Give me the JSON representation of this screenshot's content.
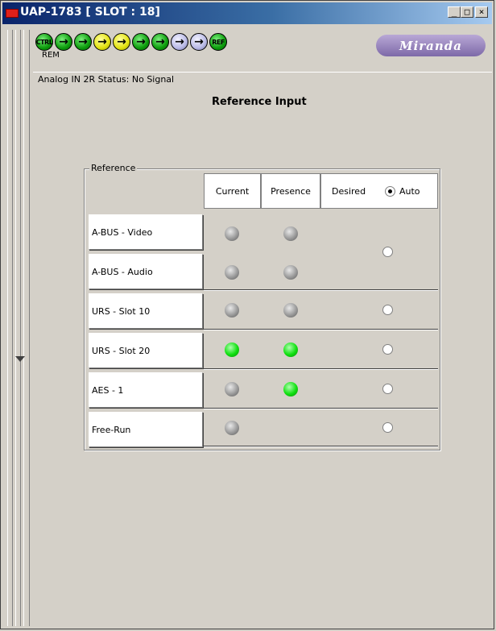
{
  "window": {
    "title": "UAP-1783 [ SLOT : 18]",
    "min_glyph": "_",
    "max_glyph": "□",
    "close_glyph": "×"
  },
  "toolbar": {
    "buttons": [
      {
        "name": "ctrl",
        "label": "CTRL",
        "color": "green"
      },
      {
        "name": "arrow-1",
        "label": "→",
        "color": "green"
      },
      {
        "name": "arrow-2",
        "label": "→",
        "color": "green"
      },
      {
        "name": "arrow-3",
        "label": "→",
        "color": "yellow"
      },
      {
        "name": "arrow-4",
        "label": "→",
        "color": "yellow"
      },
      {
        "name": "arrow-5",
        "label": "→",
        "color": "green"
      },
      {
        "name": "arrow-6",
        "label": "→",
        "color": "green"
      },
      {
        "name": "arrow-7",
        "label": "→",
        "color": "lavender"
      },
      {
        "name": "arrow-8",
        "label": "→",
        "color": "lavender"
      },
      {
        "name": "ref",
        "label": "REF",
        "color": "green"
      }
    ],
    "rem_label": "REM",
    "logo_text": "Miranda"
  },
  "status_text": "Analog IN 2R Status: No Signal",
  "page_title": "Reference Input",
  "reference": {
    "group_label": "Reference",
    "columns": {
      "current": "Current",
      "presence": "Presence",
      "desired": "Desired",
      "auto": "Auto"
    },
    "auto_selected": true,
    "rows": [
      {
        "label": "A-BUS - Video",
        "current": "grey",
        "presence": "grey"
      },
      {
        "label": "A-BUS - Audio",
        "current": "grey",
        "presence": "grey"
      },
      {
        "label": "URS - Slot 10",
        "current": "grey",
        "presence": "grey"
      },
      {
        "label": "URS - Slot 20",
        "current": "green",
        "presence": "green"
      },
      {
        "label": "AES - 1",
        "current": "grey",
        "presence": "green"
      },
      {
        "label": "Free-Run",
        "current": "grey",
        "presence": null
      }
    ]
  }
}
